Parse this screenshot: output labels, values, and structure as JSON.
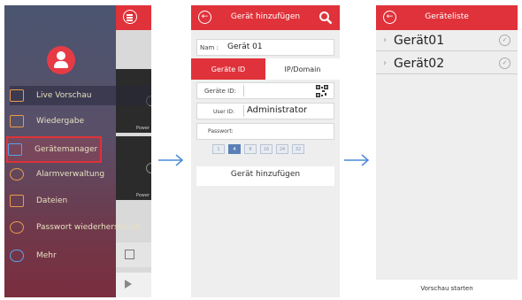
{
  "menu": {
    "items": [
      {
        "label": "Live Vorschau",
        "icon": "camera-icon"
      },
      {
        "label": "Wiedergabe",
        "icon": "playback-icon"
      },
      {
        "label": "Gerätemanager",
        "icon": "device-manager-icon"
      },
      {
        "label": "Alarmverwaltung",
        "icon": "bell-icon"
      },
      {
        "label": "Dateien",
        "icon": "image-icon"
      },
      {
        "label": "Passwort wiederherstellen",
        "icon": "gear-icon"
      },
      {
        "label": "Mehr",
        "icon": "cloud-icon"
      }
    ],
    "video_label": "Power"
  },
  "add_device": {
    "title": "Gerät hinzufügen",
    "name_label": "Nam :",
    "name_value": "Gerät 01",
    "tabs": [
      "Geräte ID",
      "IP/Domain"
    ],
    "device_id_label": "Geräte ID:",
    "user_id_label": "User ID:",
    "user_id_value": "Administrator",
    "password_label": "Passwort:",
    "channels": [
      "1",
      "4",
      "8",
      "16",
      "24",
      "32"
    ],
    "submit_label": "Gerät hinzufügen"
  },
  "device_list": {
    "title": "Geräteliste",
    "devices": [
      "Gerät01",
      "Gerät02"
    ],
    "footer_label": "Vorschau starten"
  },
  "colors": {
    "accent": "#e0323a",
    "arrow": "#3a7fd0"
  }
}
